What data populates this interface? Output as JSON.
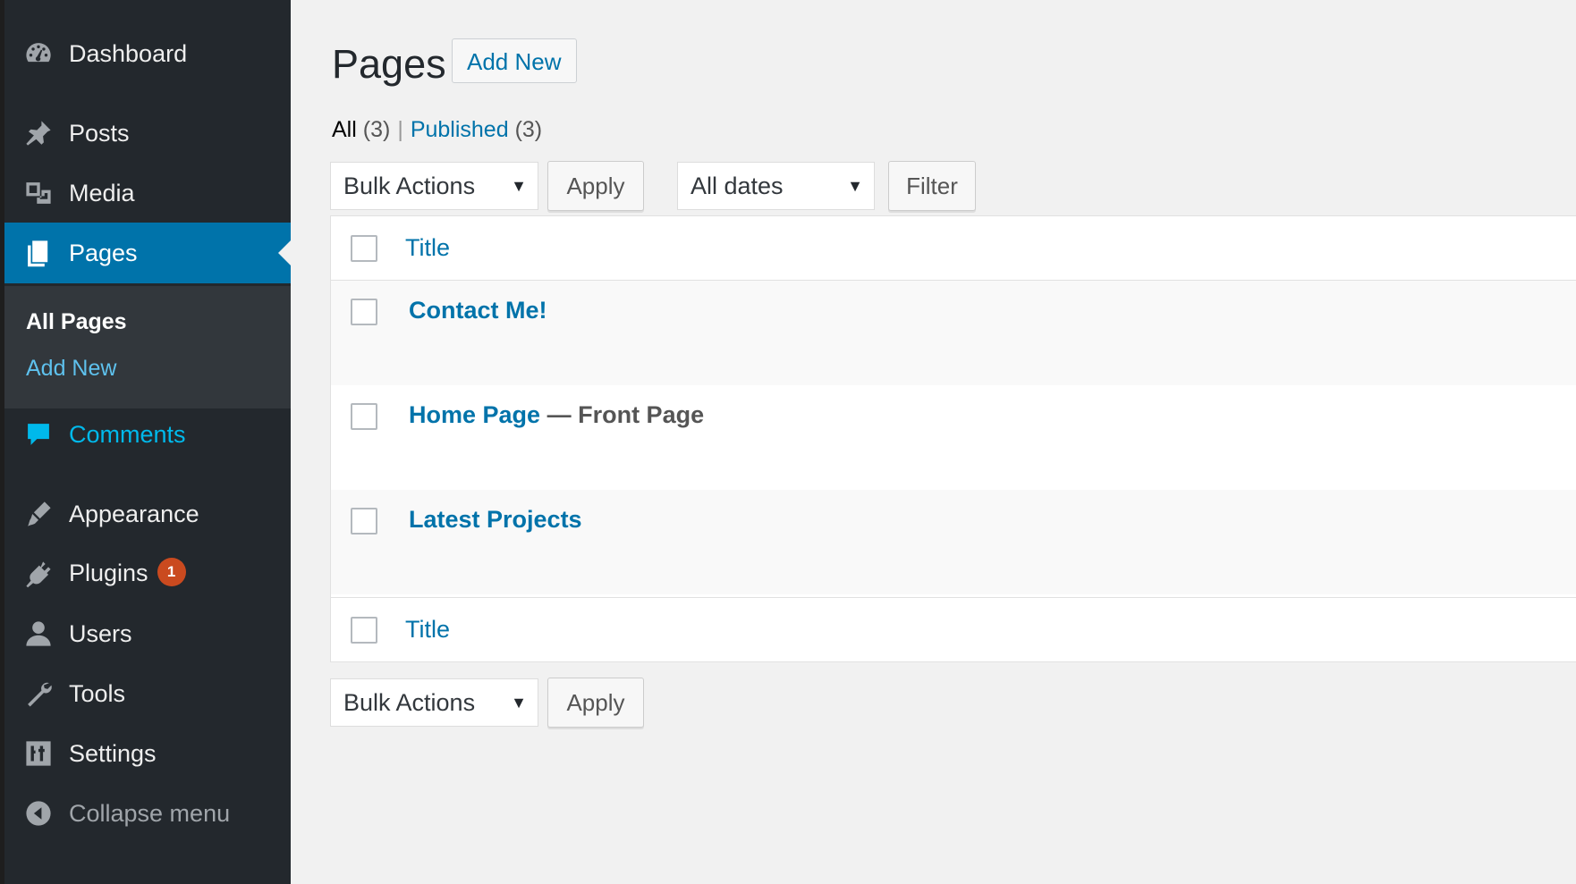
{
  "sidebar": {
    "items": [
      {
        "label": "Dashboard",
        "icon": "dashboard-icon"
      },
      {
        "label": "Posts",
        "icon": "pushpin-icon"
      },
      {
        "label": "Media",
        "icon": "media-icon"
      },
      {
        "label": "Pages",
        "icon": "pages-icon"
      },
      {
        "label": "Comments",
        "icon": "comment-bubble-icon"
      },
      {
        "label": "Appearance",
        "icon": "paintbrush-icon"
      },
      {
        "label": "Plugins",
        "icon": "plugin-icon",
        "badge": "1"
      },
      {
        "label": "Users",
        "icon": "user-icon"
      },
      {
        "label": "Tools",
        "icon": "wrench-icon"
      },
      {
        "label": "Settings",
        "icon": "settings-sliders-icon"
      },
      {
        "label": "Collapse menu",
        "icon": "collapse-arrow-icon"
      }
    ],
    "submenu": {
      "current": "All Pages",
      "other": "Add New"
    }
  },
  "main": {
    "title": "Pages",
    "add_new": "Add New",
    "filters": {
      "all_label": "All",
      "all_count": "(3)",
      "separator": "|",
      "published_label": "Published",
      "published_count": "(3)"
    },
    "bulk_actions": "Bulk Actions",
    "apply": "Apply",
    "dates": "All dates",
    "filter": "Filter",
    "table": {
      "column_title": "Title",
      "rows": [
        {
          "title": "Contact Me!",
          "state": ""
        },
        {
          "title": "Home Page",
          "state": "— Front Page"
        },
        {
          "title": "Latest Projects",
          "state": ""
        }
      ]
    }
  },
  "colors": {
    "sidebar_bg": "#23282d",
    "active_bg": "#0073aa",
    "link": "#0073aa",
    "badge": "#ca4a1f"
  }
}
